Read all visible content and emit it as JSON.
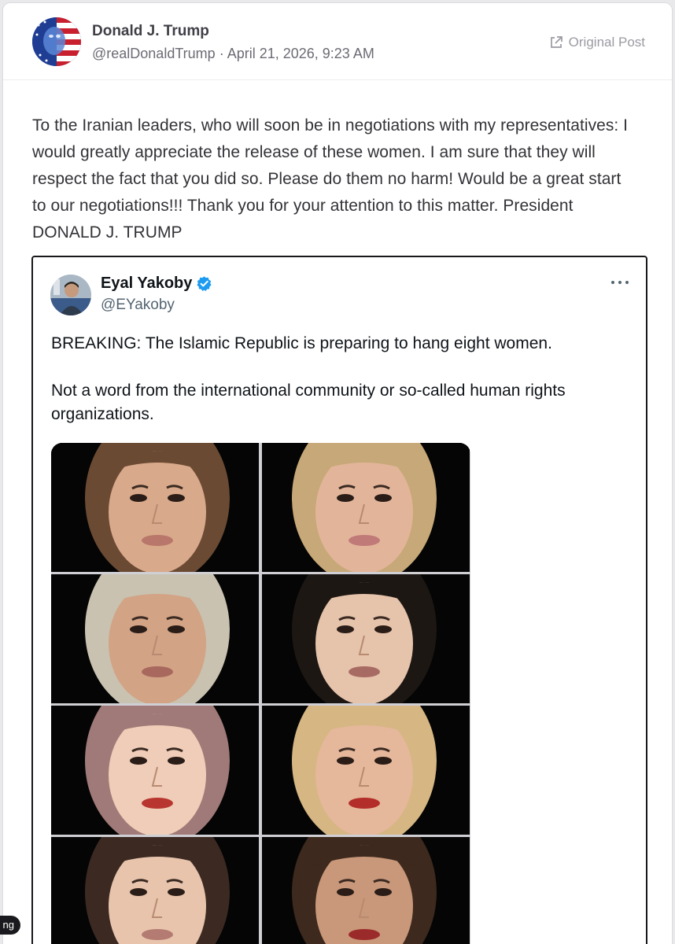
{
  "post": {
    "author_name": "Donald J. Trump",
    "author_handle": "@realDonaldTrump",
    "separator": "·",
    "timestamp": "April 21, 2026, 9:23 AM",
    "original_post_label": "Original Post",
    "body": "To the Iranian leaders, who will soon be in negotiations with my representatives: I would greatly appreciate the release of these women. I am sure that they will respect the fact that you did so. Please do them no harm! Would be a great start to our negotiations!!! Thank you for your attention to this matter. President DONALD J. TRUMP"
  },
  "quoted": {
    "author_name": "Eyal Yakoby",
    "author_handle": "@EYakoby",
    "verified": true,
    "paragraph_1": "BREAKING: The Islamic Republic is preparing to hang eight women.",
    "paragraph_2": "Not a word from the international community or so-called human rights organizations.",
    "photos": [
      {
        "hair": "#6b4a33",
        "skin": "#d8a98a",
        "lips": "#b9766a"
      },
      {
        "hair": "#c7a878",
        "skin": "#e2b59a",
        "lips": "#c07a78"
      },
      {
        "hair": "#c9c2b0",
        "skin": "#d2a385",
        "lips": "#a8685e"
      },
      {
        "hair": "#1d1714",
        "skin": "#e6c3ab",
        "lips": "#a86b63"
      },
      {
        "hair": "#a07a78",
        "skin": "#efcdb8",
        "lips": "#b8362f"
      },
      {
        "hair": "#d6b683",
        "skin": "#e5b79b",
        "lips": "#b32d2a"
      },
      {
        "hair": "#3c2a22",
        "skin": "#e8c4ad",
        "lips": "#b47b72"
      },
      {
        "hair": "#3d291d",
        "skin": "#c99779",
        "lips": "#9b2b2b"
      }
    ]
  },
  "side_pill": "ng",
  "colors": {
    "verified_badge": "#1d9bf0",
    "card_border": "#dcdce0",
    "quote_border": "#17171c"
  }
}
